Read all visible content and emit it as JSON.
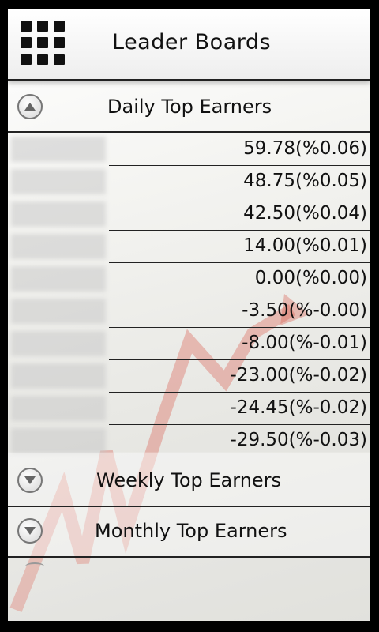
{
  "header": {
    "title": "Leader Boards",
    "menu_icon": "grid-menu-icon"
  },
  "sections": {
    "daily": {
      "title": "Daily Top Earners",
      "icon": "chevron-up-icon",
      "expanded": true
    },
    "weekly": {
      "title": "Weekly Top Earners",
      "icon": "chevron-down-icon",
      "expanded": false
    },
    "monthly": {
      "title": "Monthly Top Earners",
      "icon": "chevron-down-icon",
      "expanded": false
    }
  },
  "daily_rows": [
    {
      "value": "59.78(%0.06)"
    },
    {
      "value": "48.75(%0.05)"
    },
    {
      "value": "42.50(%0.04)"
    },
    {
      "value": "14.00(%0.01)"
    },
    {
      "value": "0.00(%0.00)"
    },
    {
      "value": "-3.50(%-0.00)"
    },
    {
      "value": "-8.00(%-0.01)"
    },
    {
      "value": "-23.00(%-0.02)"
    },
    {
      "value": "-24.45(%-0.02)"
    },
    {
      "value": "-29.50(%-0.03)"
    }
  ],
  "colors": {
    "background": "#000000",
    "panel": "#f2f2ef",
    "text": "#111111",
    "accent_arrow": "#d23a2a"
  }
}
